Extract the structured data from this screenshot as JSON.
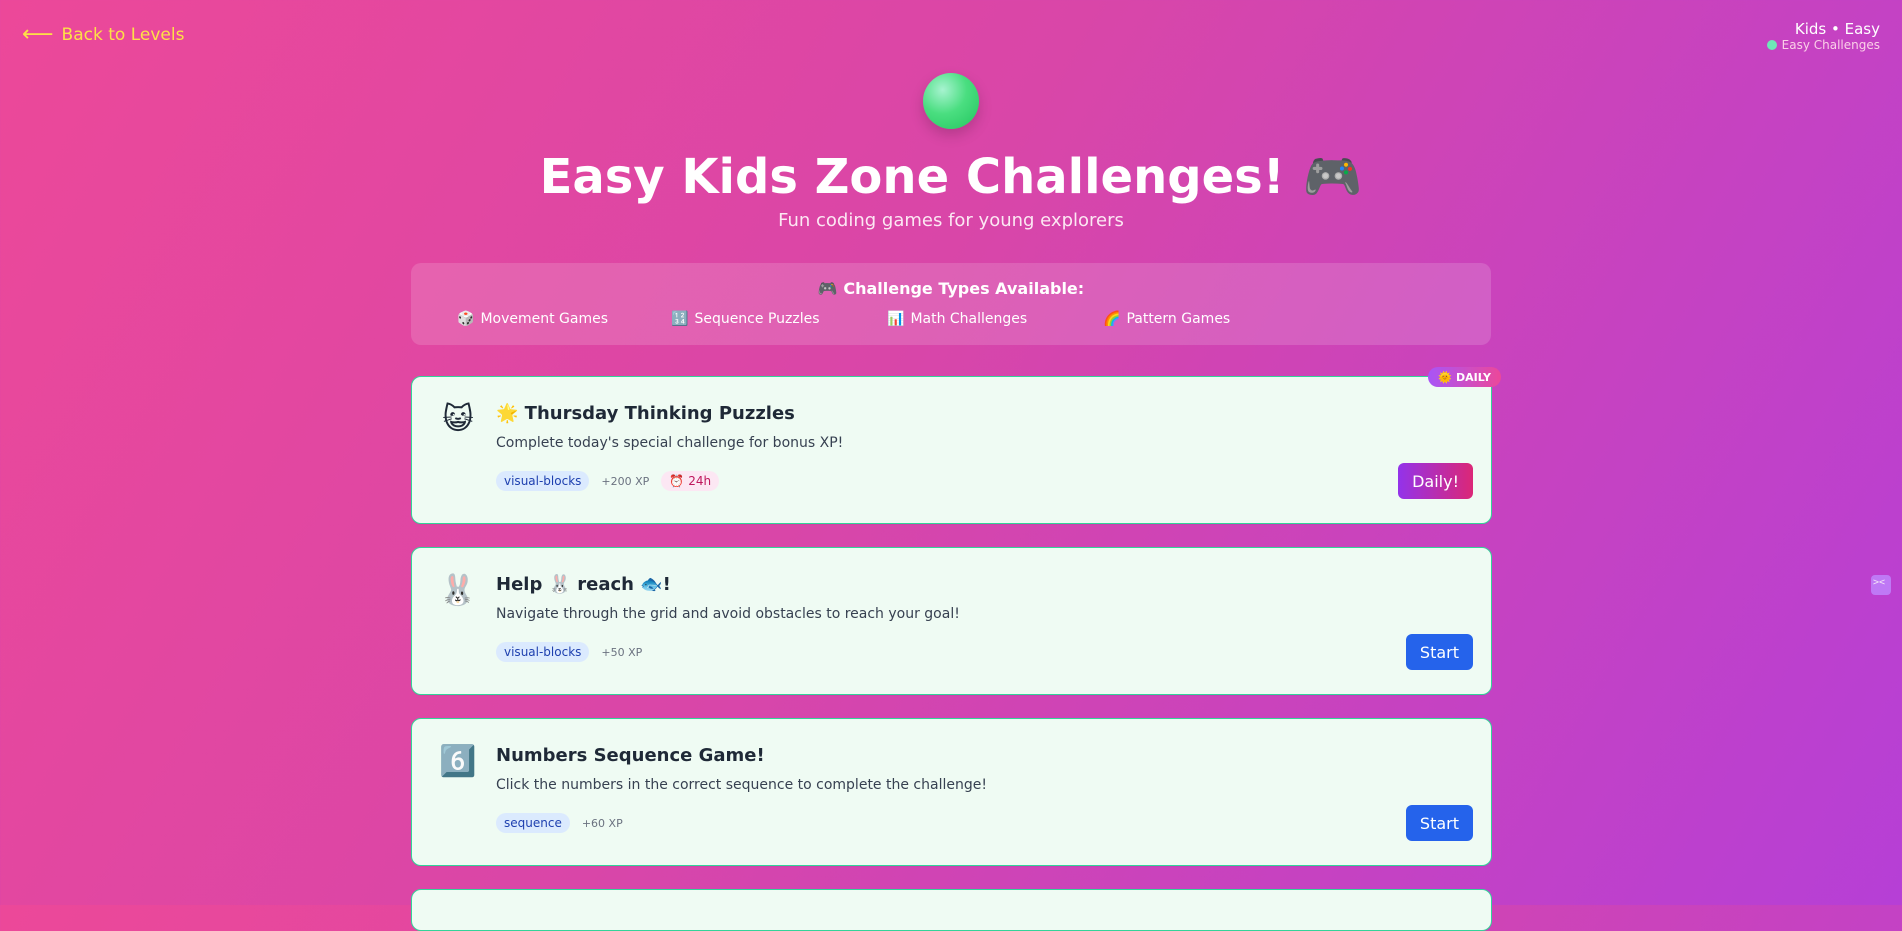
{
  "nav": {
    "back_label": "Back to Levels",
    "back_icon": "arrow-left-icon"
  },
  "level_info": {
    "title": "Kids • Easy",
    "subtitle": "Easy Challenges"
  },
  "header": {
    "title": "Easy Kids Zone Challenges!",
    "title_emoji": "🎮",
    "subtitle": "Fun coding games for young explorers"
  },
  "challenge_types": {
    "heading": "🎮 Challenge Types Available:",
    "items": [
      {
        "icon": "🎲",
        "label": "Movement Games"
      },
      {
        "icon": "🔢",
        "label": "Sequence Puzzles"
      },
      {
        "icon": "📊",
        "label": "Math Challenges"
      },
      {
        "icon": "🌈",
        "label": "Pattern Games"
      }
    ]
  },
  "cards": [
    {
      "emoji": "😺",
      "title": "🌟 Thursday Thinking Puzzles",
      "description": "Complete today's special challenge for bonus XP!",
      "tag": "visual-blocks",
      "xp": "+200 XP",
      "timer": "24h",
      "button": "Daily!",
      "badge": "DAILY"
    },
    {
      "emoji": "🐰",
      "title": "Help 🐰 reach 🐟!",
      "description": "Navigate through the grid and avoid obstacles to reach your goal!",
      "tag": "visual-blocks",
      "xp": "+50 XP",
      "button": "Start"
    },
    {
      "emoji": "6️⃣",
      "title": "Numbers Sequence Game!",
      "description": "Click the numbers in the correct sequence to complete the challenge!",
      "tag": "sequence",
      "xp": "+60 XP",
      "button": "Start"
    }
  ],
  "colors": {
    "accent_start": "#2563eb",
    "daily_gradient": [
      "#9333ea",
      "#db2777"
    ],
    "card_border": "#34d399"
  }
}
